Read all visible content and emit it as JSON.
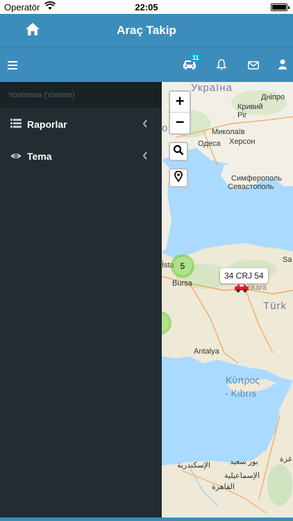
{
  "status": {
    "carrier": "Operatör",
    "time": "22:05"
  },
  "header": {
    "title": "Araç Takip"
  },
  "toolbar": {
    "vehicle_badge": "11"
  },
  "sidebar": {
    "user": "Yontemas (Yontem)",
    "items": [
      {
        "label": "Raporlar"
      },
      {
        "label": "Tema"
      }
    ]
  },
  "map": {
    "zoom_in": "+",
    "zoom_out": "−",
    "labels": {
      "ukraine": "Україна",
      "dnipro": "Дніпро",
      "kryvyi": "Кривий Ріг",
      "mykolaiv": "Миколаїв",
      "kherson": "Херсон",
      "odesa": "Одеса",
      "moldova": "ova",
      "simferopol": "Симферополь",
      "sevastopol": "Севастополь",
      "istanbul": "İstanbul",
      "bursa": "Bursa",
      "turkey": "Türk",
      "antalya": "Antalya",
      "cyprus1": "Κύπρος",
      "cyprus2": "- Kıbrıs",
      "port_said": "بور سعيد",
      "gaza": "غزة",
      "alexandria": "الإسكندرية",
      "ismailia": "الإسماعيلية",
      "cairo": "القاهرة",
      "sa": "Sa",
      "ankara_partial": "Ankara"
    },
    "cluster_count": "5",
    "vehicle_plate": "34 CRJ 54"
  },
  "colors": {
    "primary": "#3c8dbc",
    "sidebar": "#222d32",
    "vehicle": "#dd2222"
  }
}
